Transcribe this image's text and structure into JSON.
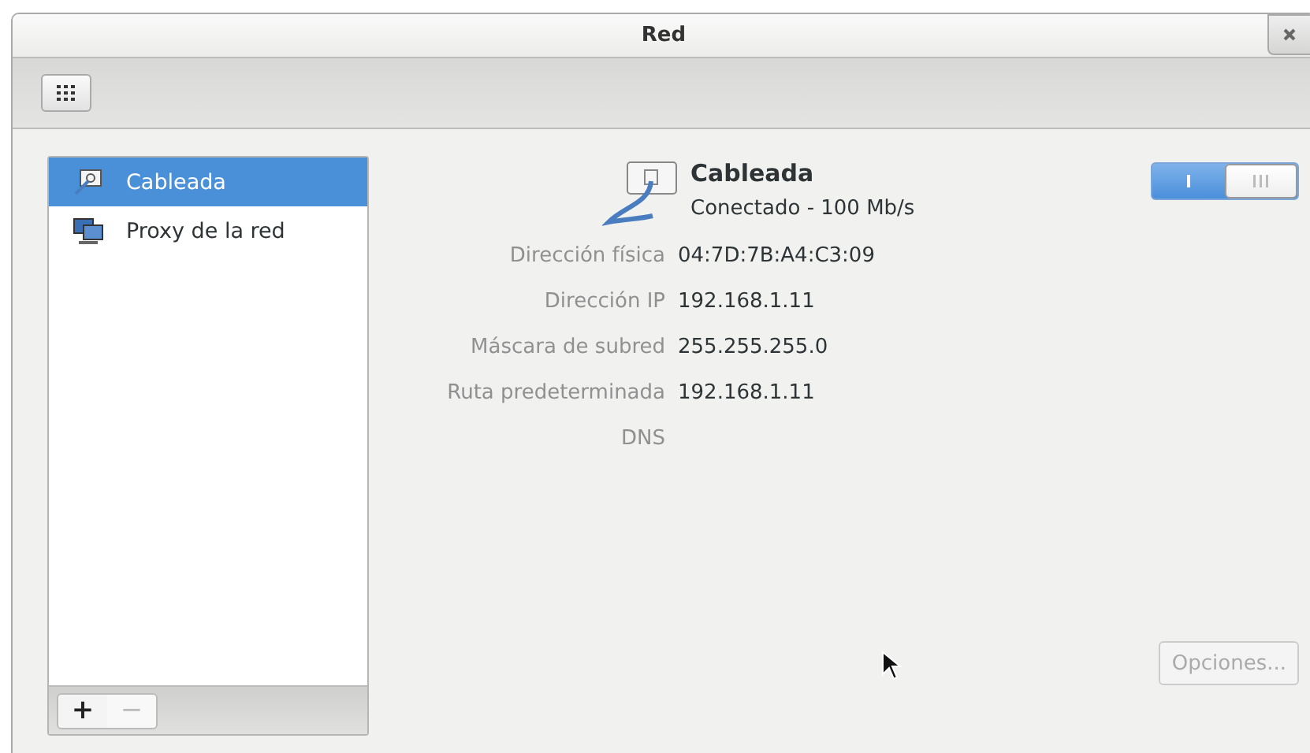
{
  "window": {
    "title": "Red"
  },
  "sidebar": {
    "items": [
      {
        "label": "Cableada",
        "kind": "wired",
        "selected": true
      },
      {
        "label": "Proxy de la red",
        "kind": "proxy",
        "selected": false
      }
    ],
    "add_button": {
      "label": "+",
      "disabled": false
    },
    "remove_button": {
      "label": "−",
      "disabled": true
    }
  },
  "device": {
    "name": "Cableada",
    "status": "Conectado - 100 Mb/s",
    "switch_on": true
  },
  "details": [
    {
      "label": "Dirección física",
      "value": "04:7D:7B:A4:C3:09"
    },
    {
      "label": "Dirección IP",
      "value": "192.168.1.11"
    },
    {
      "label": "Máscara de subred",
      "value": "255.255.255.0"
    },
    {
      "label": "Ruta predeterminada",
      "value": "192.168.1.11"
    },
    {
      "label": "DNS"
    }
  ],
  "options_button": {
    "label": "Opciones...",
    "disabled": true
  }
}
